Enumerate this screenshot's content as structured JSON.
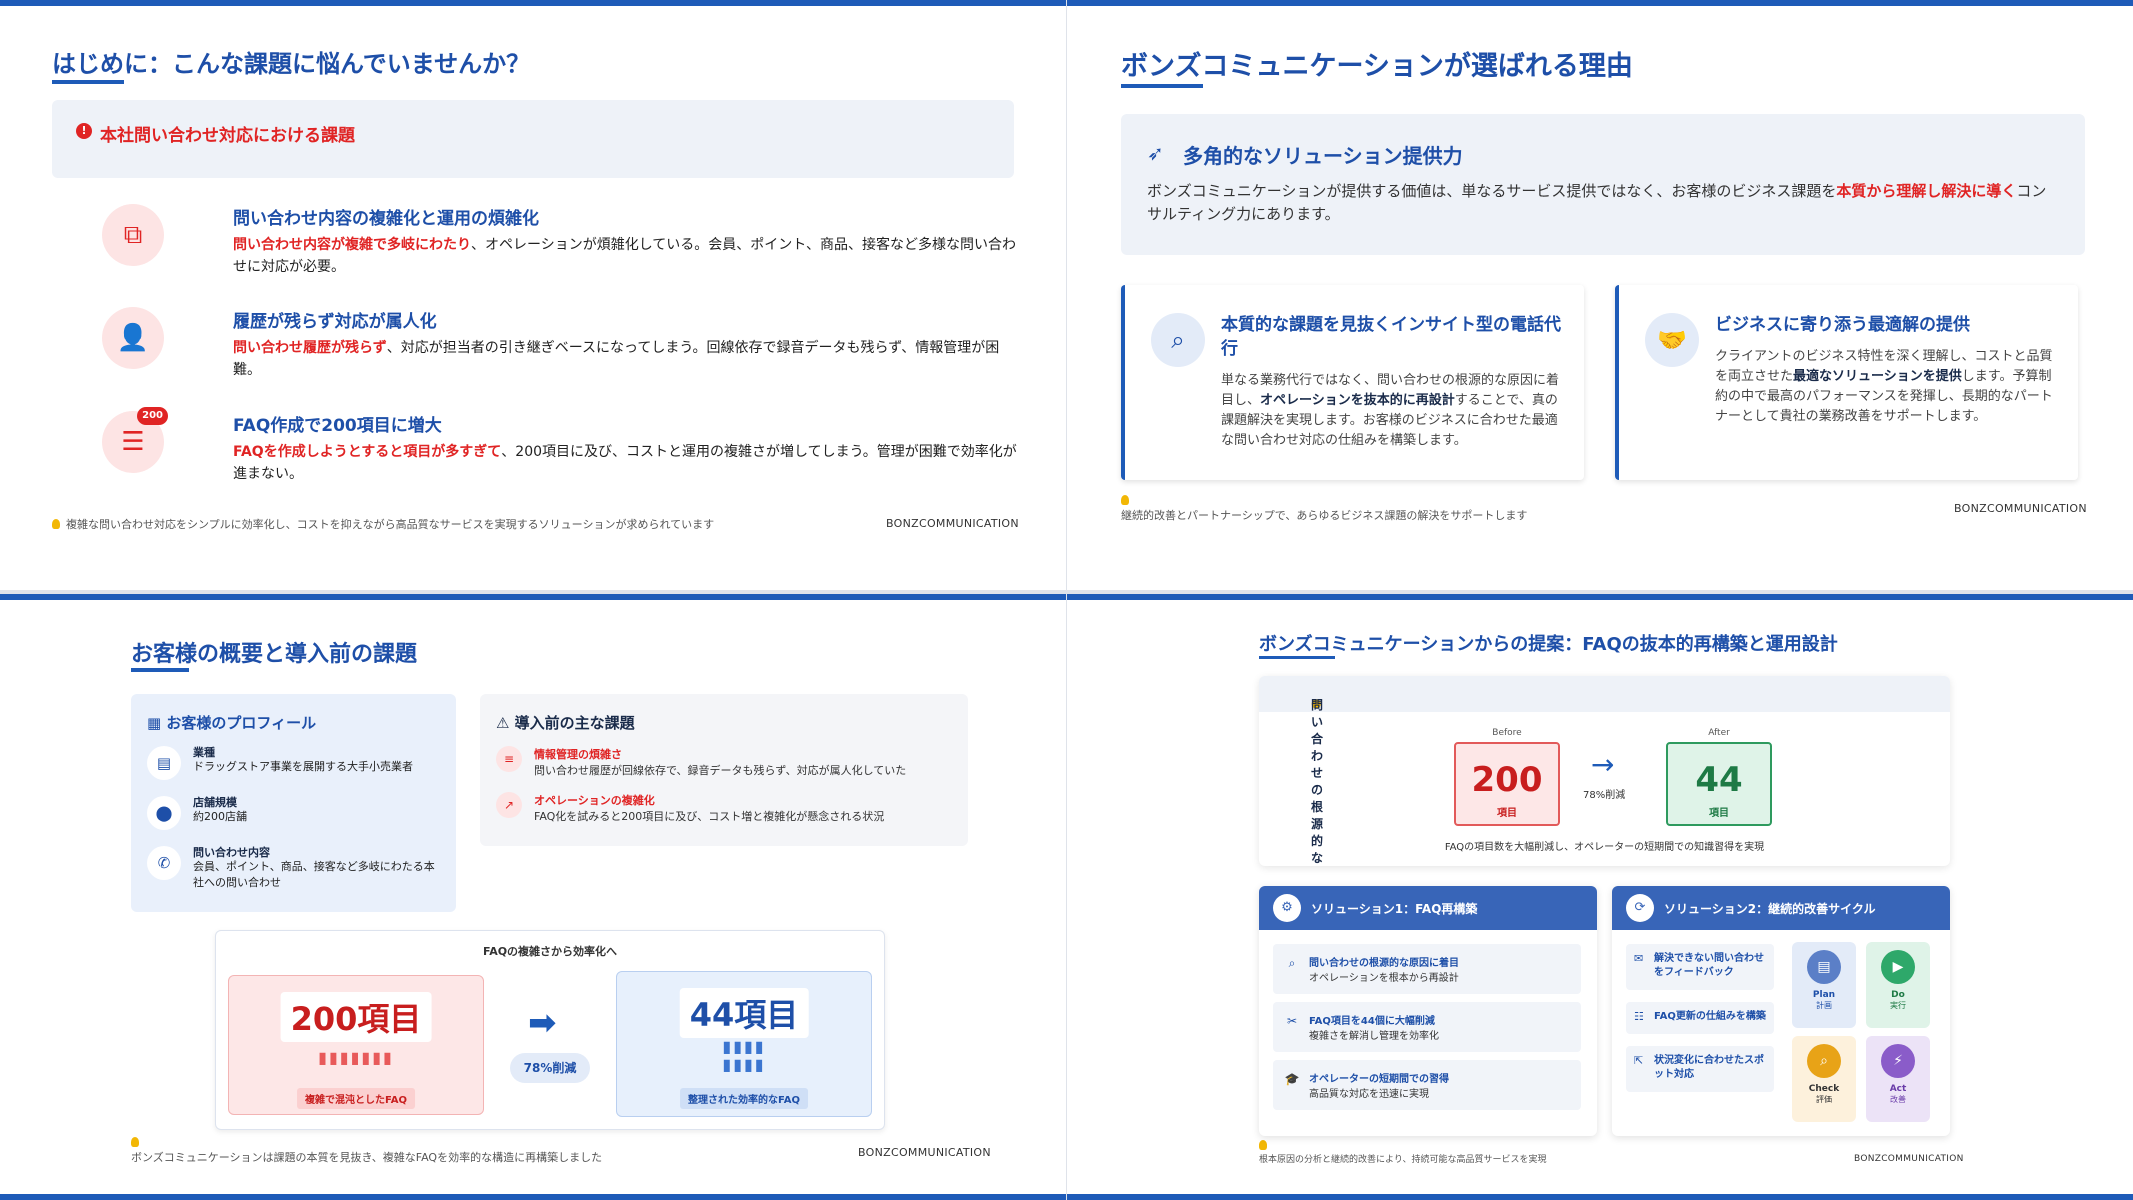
{
  "brand": "BONZCOMMUNICATION",
  "slide1": {
    "title": "はじめに：こんな課題に悩んでいませんか？",
    "alert": "本社問い合わせ対応における課題",
    "items": [
      {
        "icon": "sitemap-icon",
        "title": "問い合わせ内容の複雑化と運用の煩雑化",
        "highlight": "問い合わせ内容が複雑で多岐にわたり",
        "body": "、オペレーションが煩雑化している。会員、ポイント、商品、接客など多様な問い合わせに対応が必要。"
      },
      {
        "icon": "user-x-icon",
        "title": "履歴が残らず対応が属人化",
        "highlight": "問い合わせ履歴が残らず",
        "body": "、対応が担当者の引き継ぎベースになってしまう。回線依存で録音データも残らず、情報管理が困難。"
      },
      {
        "icon": "list-icon",
        "badge": "200",
        "title": "FAQ作成で200項目に増大",
        "highlight": "FAQを作成しようとすると項目が多すぎて",
        "body": "、200項目に及び、コストと運用の複雑さが増してしまう。管理が困難で効率化が進まない。"
      }
    ],
    "footer": "複雑な問い合わせ対応をシンプルに効率化し、コストを抑えながら高品質なサービスを実現するソリューションが求められています"
  },
  "slide2": {
    "title": "ボンズコミュニケーションが選ばれる理由",
    "box_title": "多角的なソリューション提供力",
    "box_pre": "ボンズコミュニケーションが提供する価値は、単なるサービス提供ではなく、お客様のビジネス課題を",
    "box_hl": "本質から理解し解決に導く",
    "box_post": "コンサルティング力にあります。",
    "card1": {
      "title": "本質的な課題を見抜くインサイト型の電話代行",
      "p1": "単なる業務代行ではなく、問い合わせの根源的な原因に着目し、",
      "bold": "オペレーションを抜本的に再設計",
      "p2": "することで、真の課題解決を実現します。お客様のビジネスに合わせた最適な問い合わせ対応の仕組みを構築します。"
    },
    "card2": {
      "title": "ビジネスに寄り添う最適解の提供",
      "p1": "クライアントのビジネス特性を深く理解し、コストと品質を両立させた",
      "bold": "最適なソリューションを提供",
      "p2": "します。予算制約の中で最高のパフォーマンスを発揮し、長期的なパートナーとして貴社の業務改善をサポートします。"
    },
    "footer": "継続的改善とパートナーシップで、あらゆるビジネス課題の解決をサポートします"
  },
  "slide3": {
    "title": "お客様の概要と導入前の課題",
    "profile_title": "お客様のプロフィール",
    "profile": [
      {
        "label": "業種",
        "value": "ドラッグストア事業を展開する大手小売業者"
      },
      {
        "label": "店舗規模",
        "value": "約200店舗"
      },
      {
        "label": "問い合わせ内容",
        "value": "会員、ポイント、商品、接客など多岐にわたる本社への問い合わせ"
      }
    ],
    "issues_title": "導入前の主な課題",
    "issues": [
      {
        "label": "情報管理の煩雑さ",
        "value": "問い合わせ履歴が回線依存で、録音データも残らず、対応が属人化していた"
      },
      {
        "label": "オペレーションの複雑化",
        "value": "FAQ化を試みると200項目に及び、コスト増と複雑化が懸念される状況"
      }
    ],
    "diagram_title": "FAQの複雑さから効率化へ",
    "before": "200項目",
    "before_label": "複雑で混沌としたFAQ",
    "after": "44項目",
    "after_label": "整理された効率的なFAQ",
    "reduction": "78%削減",
    "footer": "ボンズコミュニケーションは課題の本質を見抜き、複雑なFAQを効率的な構造に再構築しました"
  },
  "slide4": {
    "title": "ボンズコミュニケーションからの提案：FAQの抜本的再構築と運用設計",
    "top_title": "問い合わせの根源的な原因に着目した抜本的ソリューション",
    "before_cap": "Before",
    "before_num": "200",
    "before_unit": "項目",
    "after_cap": "After",
    "after_num": "44",
    "after_unit": "項目",
    "reduction": "78%削減",
    "caption": "FAQの項目数を大幅削減し、オペレーターの短期間での知識習得を実現",
    "sol1_title": "ソリューション1：FAQ再構築",
    "sol1": [
      {
        "label": "問い合わせの根源的な原因に着目",
        "value": "オペレーションを根本から再設計"
      },
      {
        "label": "FAQ項目を44個に大幅削減",
        "value": "複雑さを解消し管理を効率化"
      },
      {
        "label": "オペレーターの短期間での習得",
        "value": "高品質な対応を迅速に実現"
      }
    ],
    "sol2_title": "ソリューション2：継続的改善サイクル",
    "sol2": [
      {
        "label": "解決できない問い合わせをフィードバック"
      },
      {
        "label": "FAQ更新の仕組みを構築"
      },
      {
        "label": "状況変化に合わせたスポット対応"
      }
    ],
    "pdca": [
      {
        "label": "Plan",
        "sub": "計画",
        "color": "#5b7fc7",
        "bg": "#e3ebf8"
      },
      {
        "label": "Do",
        "sub": "実行",
        "color": "#2ea86a",
        "bg": "#dff3e8"
      },
      {
        "label": "Check",
        "sub": "評価",
        "color": "#e8a317",
        "bg": "#fdf1dc"
      },
      {
        "label": "Act",
        "sub": "改善",
        "color": "#8a5cc9",
        "bg": "#ece3f7"
      }
    ],
    "footer": "根本原因の分析と継続的改善により、持続可能な高品質サービスを実現"
  }
}
